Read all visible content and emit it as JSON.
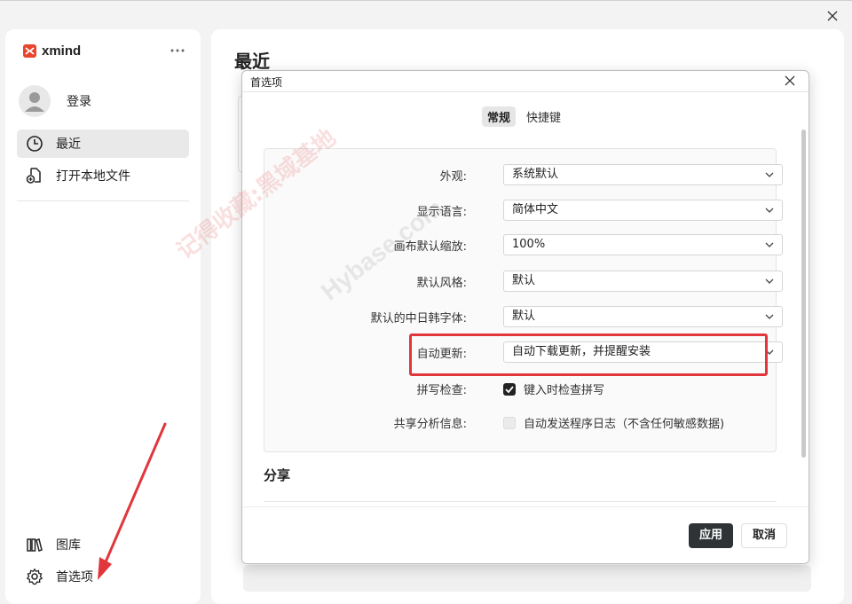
{
  "app": {
    "logo_text": "xmind",
    "brand_color": "#e8452f"
  },
  "sidebar": {
    "login_label": "登录",
    "nav_items": [
      {
        "label": "最近",
        "icon": "clock-icon",
        "active": true
      },
      {
        "label": "打开本地文件",
        "icon": "file-add-icon",
        "active": false
      }
    ],
    "bottom_items": [
      {
        "label": "图库",
        "icon": "library-icon"
      },
      {
        "label": "首选项",
        "icon": "gear-icon"
      }
    ]
  },
  "main": {
    "title": "最近"
  },
  "dialog": {
    "title": "首选项",
    "tabs": [
      {
        "label": "常规",
        "active": true
      },
      {
        "label": "快捷键",
        "active": false
      }
    ],
    "settings": [
      {
        "label": "外观:",
        "value": "系统默认"
      },
      {
        "label": "显示语言:",
        "value": "简体中文"
      },
      {
        "label": "画布默认缩放:",
        "value": "100%"
      },
      {
        "label": "默认风格:",
        "value": "默认"
      },
      {
        "label": "默认的中日韩字体:",
        "value": "默认"
      },
      {
        "label": "自动更新:",
        "value": "自动下载更新，并提醒安装",
        "highlighted": true
      }
    ],
    "checks": [
      {
        "label": "拼写检查:",
        "text": "键入时检查拼写",
        "checked": true
      },
      {
        "label": "共享分析信息:",
        "text": "自动发送程序日志（不含任何敏感数据)",
        "checked": false
      }
    ],
    "share_section_title": "分享",
    "apply_label": "应用",
    "cancel_label": "取消"
  },
  "overlays": {
    "watermark_cn": "记得收藏:黑域基地",
    "watermark_en": "Hybase.com",
    "highlight_color": "#e0363c",
    "arrow_color": "#e0363c"
  }
}
